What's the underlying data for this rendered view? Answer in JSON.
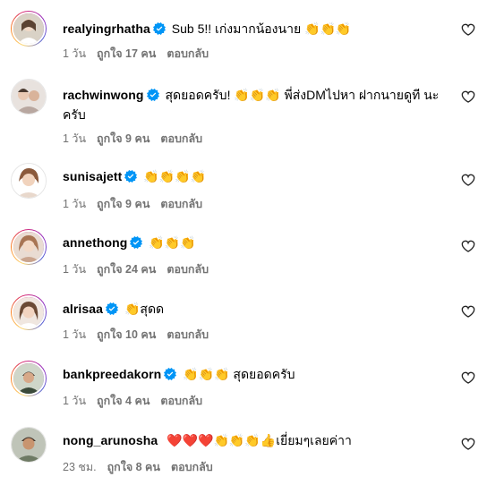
{
  "comments": [
    {
      "username": "realyingrhatha",
      "text": "Sub 5!! เก่งมากน้องนาย 👏👏👏",
      "time": "1 วัน",
      "likes": "ถูกใจ 17 คน",
      "reply": "ตอบกลับ"
    },
    {
      "username": "rachwinwong",
      "text": "สุดยอดครับ! 👏👏👏 พี่ส่งDMไปหา ฝากนายดูที นะครับ",
      "time": "1 วัน",
      "likes": "ถูกใจ 9 คน",
      "reply": "ตอบกลับ"
    },
    {
      "username": "sunisajett",
      "text": "👏👏👏👏",
      "time": "1 วัน",
      "likes": "ถูกใจ 9 คน",
      "reply": "ตอบกลับ"
    },
    {
      "username": "annethong",
      "text": "👏👏👏",
      "time": "1 วัน",
      "likes": "ถูกใจ 24 คน",
      "reply": "ตอบกลับ"
    },
    {
      "username": "alrisaa",
      "text": "👏สุดด",
      "time": "1 วัน",
      "likes": "ถูกใจ 10 คน",
      "reply": "ตอบกลับ"
    },
    {
      "username": "bankpreedakorn",
      "text": "👏👏👏 สุดยอดครับ",
      "time": "1 วัน",
      "likes": "ถูกใจ 4 คน",
      "reply": "ตอบกลับ"
    },
    {
      "username": "nong_arunosha",
      "text": "❤️❤️❤️👏👏👏👍เยี่ยมๆเลยค่าา",
      "time": "23 ชม.",
      "likes": "ถูกใจ 8 คน",
      "reply": "ตอบกลับ"
    }
  ],
  "icons": {
    "verified": "verified-badge-icon",
    "like": "heart-outline-icon"
  },
  "colors": {
    "verified": "#0095f6",
    "meta": "#737373"
  }
}
